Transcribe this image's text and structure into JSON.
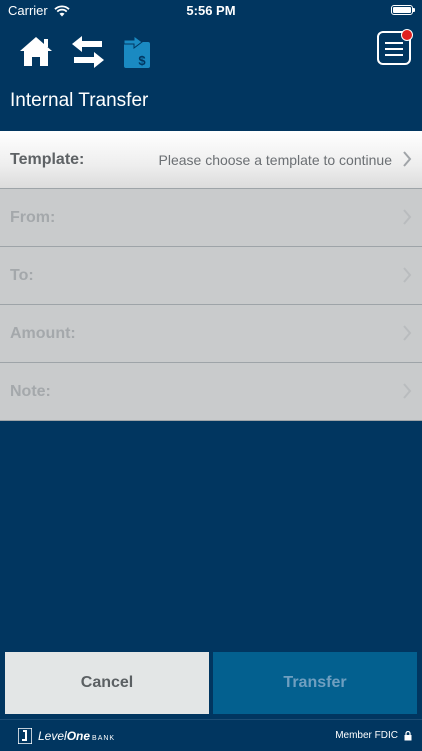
{
  "status": {
    "carrier": "Carrier",
    "time": "5:56 PM"
  },
  "nav": {
    "page_title": "Internal Transfer"
  },
  "form": {
    "rows": [
      {
        "label": "Template:",
        "value": "Please choose a template to continue"
      },
      {
        "label": "From:",
        "value": ""
      },
      {
        "label": "To:",
        "value": ""
      },
      {
        "label": "Amount:",
        "value": ""
      },
      {
        "label": "Note:",
        "value": ""
      }
    ]
  },
  "actions": {
    "cancel_label": "Cancel",
    "transfer_label": "Transfer"
  },
  "footer": {
    "brand_level": "Level",
    "brand_one": "One",
    "brand_bank": "BANK",
    "member": "Member FDIC"
  },
  "colors": {
    "background": "#013660",
    "transfer_button": "#03608f",
    "notification": "#e02020"
  },
  "icons": [
    "wifi-icon",
    "battery-icon",
    "home-icon",
    "swap-arrows-icon",
    "transfer-dollar-icon",
    "menu-icon",
    "chevron-right-icon",
    "lock-icon",
    "levelone-logo-icon"
  ]
}
